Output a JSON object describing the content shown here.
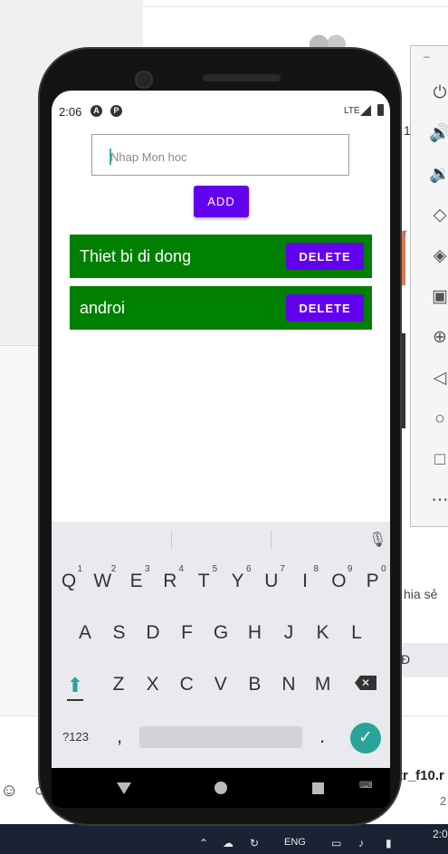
{
  "background": {
    "snippet_text": "hia sẻ",
    "bar_label": "Đ",
    "bottom_filename": "tr_f10.r",
    "bottom_number": "2",
    "right_label_1": "1",
    "right_label_2": "r"
  },
  "taskbar": {
    "lang": "ENG",
    "time": "2:0"
  },
  "emulator_toolbar": {
    "minimize": "–",
    "buttons": [
      "power-icon",
      "volume-up-icon",
      "volume-down-icon",
      "rotate-left-icon",
      "rotate-right-icon",
      "camera-icon",
      "zoom-icon",
      "back-icon",
      "home-icon",
      "overview-icon",
      "more-icon"
    ]
  },
  "status_bar": {
    "time": "2:06",
    "network": "LTE"
  },
  "form": {
    "input_value": "",
    "input_placeholder": "Nhap Mon hoc",
    "add_label": "ADD"
  },
  "list": {
    "items": [
      {
        "label": "Thiet bi di dong",
        "delete_label": "DELETE"
      },
      {
        "label": "androi",
        "delete_label": "DELETE"
      }
    ]
  },
  "keyboard": {
    "row1": [
      {
        "key": "Q",
        "hint": "1"
      },
      {
        "key": "W",
        "hint": "2"
      },
      {
        "key": "E",
        "hint": "3"
      },
      {
        "key": "R",
        "hint": "4"
      },
      {
        "key": "T",
        "hint": "5"
      },
      {
        "key": "Y",
        "hint": "6"
      },
      {
        "key": "U",
        "hint": "7"
      },
      {
        "key": "I",
        "hint": "8"
      },
      {
        "key": "O",
        "hint": "9"
      },
      {
        "key": "P",
        "hint": "0"
      }
    ],
    "row2": [
      "A",
      "S",
      "D",
      "F",
      "G",
      "H",
      "J",
      "K",
      "L"
    ],
    "row3": [
      "Z",
      "X",
      "C",
      "V",
      "B",
      "N",
      "M"
    ],
    "symbols_label": "?123",
    "comma": ",",
    "period": "."
  },
  "colors": {
    "accent": "#6200ee",
    "list_bg": "#008000",
    "keyboard_teal": "#2aa39a"
  }
}
